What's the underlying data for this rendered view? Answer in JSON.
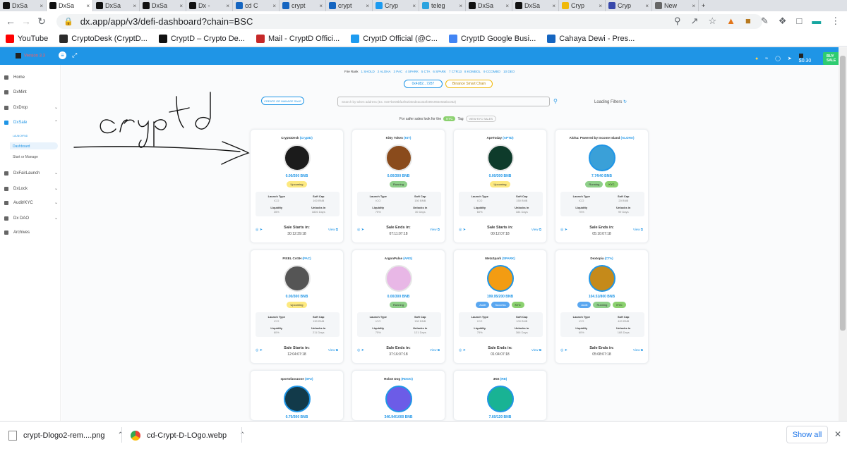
{
  "browser": {
    "tabs": [
      {
        "label": "DxSa",
        "active": false
      },
      {
        "label": "DxSa",
        "active": true
      },
      {
        "label": "DxSa",
        "active": false
      },
      {
        "label": "DxSa",
        "active": false
      },
      {
        "label": "Dx -",
        "active": false
      },
      {
        "label": "cd C",
        "active": false
      },
      {
        "label": "crypt",
        "active": false
      },
      {
        "label": "crypt",
        "active": false
      },
      {
        "label": "Cryp",
        "active": false
      },
      {
        "label": "teleg",
        "active": false
      },
      {
        "label": "DxSa",
        "active": false
      },
      {
        "label": "DxSa",
        "active": false
      },
      {
        "label": "Cryp",
        "active": false
      },
      {
        "label": "Cryp",
        "active": false
      },
      {
        "label": "New",
        "active": false
      }
    ],
    "url": "dx.app/app/v3/defi-dashboard?chain=BSC",
    "bookmarks": [
      {
        "label": "YouTube",
        "color": "#ff0000"
      },
      {
        "label": "CryptoDesk (CryptD...",
        "color": "#2b2b2b"
      },
      {
        "label": "CryptD – Crypto De...",
        "color": "#111111"
      },
      {
        "label": "Mail - CryptD Offici...",
        "color": "#c62828"
      },
      {
        "label": "CryptD Official (@C...",
        "color": "#1d9bf0"
      },
      {
        "label": "CryptD Google Busi...",
        "color": "#4285f4"
      },
      {
        "label": "Cahaya Dewi - Pres...",
        "color": "#1565c0"
      }
    ]
  },
  "app": {
    "version": "Version 3.3",
    "balance": "$0.30",
    "buy_sale": "BUY SALE",
    "colors": {
      "primary": "#1f95e6",
      "upcoming": "#fde980",
      "running": "#8fd08a",
      "kyc": "#8bd16f"
    }
  },
  "sidebar": {
    "items": [
      {
        "label": "Home"
      },
      {
        "label": "DxMint"
      },
      {
        "label": "DxDrop"
      },
      {
        "label": "DxSale",
        "active": true
      },
      {
        "label": "DxFairLaunch"
      },
      {
        "label": "DxLock"
      },
      {
        "label": "Audit/KYC"
      },
      {
        "label": "Dx DAO"
      },
      {
        "label": "Archives"
      }
    ],
    "sub": [
      "LAUNCHPAD",
      "Dashboard",
      "Start or Manage"
    ]
  },
  "filters": {
    "chains": [
      "Fire Rank",
      "1 SHOLD",
      "2 ALOHA",
      "3 PAC",
      "4 SPARK",
      "5 CTA",
      "6 SPARK",
      "7 CTR13",
      "8 KOMBOL",
      "9 CCOMBO",
      "10 DEO"
    ],
    "wallet": "0x4d82...7287",
    "network": "Binance Smart Chain",
    "create_btn": "CREATE OR MANAGE SALE",
    "search_placeholder": "Search by token address (Ex. 0x97be08bfa4f02b0edeac333f499c966e9a6bc052)",
    "loading": "Loading Filters",
    "kyc_note": "For safer sales look for the",
    "kyc_chip": "KYC",
    "kyc_tag": "Tag",
    "view_kyc": "VIEW KYC SALES"
  },
  "annotation": "cryptd",
  "cards": [
    {
      "name": "CryptoDesk",
      "sym": "(CryptD)",
      "raised": "0.00/200 BNB",
      "badges": [
        "Upcoming"
      ],
      "lt": "ICO",
      "sc": "100 BNB",
      "liq": "35%",
      "unlock": "1826 Days",
      "footer": "Sale Starts in:",
      "time": "30:12:39:18",
      "logo": "#1b1b1b"
    },
    {
      "name": "Kitty Token",
      "sym": "(KIT)",
      "raised": "0.00/300 BNB",
      "badges": [
        "Running"
      ],
      "lt": "ICO",
      "sc": "150 BNB",
      "liq": "75%",
      "unlock": "30 Days",
      "footer": "Sale Ends in:",
      "time": "07:11:07:18",
      "logo": "#8a4b1c"
    },
    {
      "name": "ApeToday",
      "sym": "(APTD)",
      "raised": "0.00/300 BNB",
      "badges": [
        "Upcoming"
      ],
      "lt": "ICO",
      "sc": "150 BNB",
      "liq": "60%",
      "unlock": "184 Days",
      "footer": "Sale Starts in:",
      "time": "00:12:07:18",
      "logo": "#0e3b2b"
    },
    {
      "name": "Aloha: Powered by Income Island",
      "sym": "(ALOHA)",
      "raised": "7.74/40 BNB",
      "badges": [
        "Running",
        "KYC"
      ],
      "lt": "ICO",
      "sc": "20 BNB",
      "liq": "70%",
      "unlock": "99 Days",
      "footer": "Sale Ends in:",
      "time": "05:10:07:18",
      "logo": "#3aa0d8"
    },
    {
      "name": "PIXEL CASH",
      "sym": "(PAC)",
      "raised": "0.00/300 BNB",
      "badges": [
        "Upcoming"
      ],
      "lt": "ICO",
      "sc": "150 BNB",
      "liq": "60%",
      "unlock": "211 Days",
      "footer": "Sale Starts in:",
      "time": "12:04:07:18",
      "logo": "#555555"
    },
    {
      "name": "ArgonPulse",
      "sym": "(ARG)",
      "raised": "0.00/300 BNB",
      "badges": [
        "Running"
      ],
      "lt": "ICO",
      "sc": "150 BNB",
      "liq": "75%",
      "unlock": "121 Days",
      "footer": "Sale Ends in:",
      "time": "37:16:07:18",
      "logo": "#e8b7e6"
    },
    {
      "name": "MetaSpark",
      "sym": "(SPARK)",
      "raised": "199.95/200 BNB",
      "badges": [
        "Audit",
        "Success",
        "KYC"
      ],
      "lt": "ICO",
      "sc": "100 BNB",
      "liq": "75%",
      "unlock": "366 Days",
      "footer": "Sale Ends in:",
      "time": "01:04:07:18",
      "logo": "#f39c12"
    },
    {
      "name": "Dextopia",
      "sym": "(CTA)",
      "raised": "104.51/800 BNB",
      "badges": [
        "Audit",
        "Running",
        "KYC"
      ],
      "lt": "ICO",
      "sc": "400 BNB",
      "liq": "60%",
      "unlock": "188 Days",
      "footer": "Sale Ends in:",
      "time": "05:08:07:18",
      "logo": "#c58a1a"
    },
    {
      "name": "sportsfanszone",
      "sym": "(SFZ)",
      "raised": "0.70/300 BNB",
      "badges": [],
      "logo": "#123a4a"
    },
    {
      "name": "Robot Dog",
      "sym": "(RDOG)",
      "raised": "346.94/1000 BNB",
      "badges": [],
      "logo": "#6c5ce7"
    },
    {
      "name": "3KE",
      "sym": "(RB)",
      "raised": "7.60/120 BNB",
      "badges": [],
      "logo": "#19b394"
    }
  ],
  "labels": {
    "launch_type": "Launch Type",
    "soft_cap": "Soft Cap",
    "liquidity": "Liquidity",
    "unlocks": "Unlocks in",
    "view": "View"
  },
  "downloads": [
    {
      "name": "crypt-Dlogo2-rem....png"
    },
    {
      "name": "cd-Crypt-D-LOgo.webp"
    }
  ],
  "show_all": "Show all"
}
